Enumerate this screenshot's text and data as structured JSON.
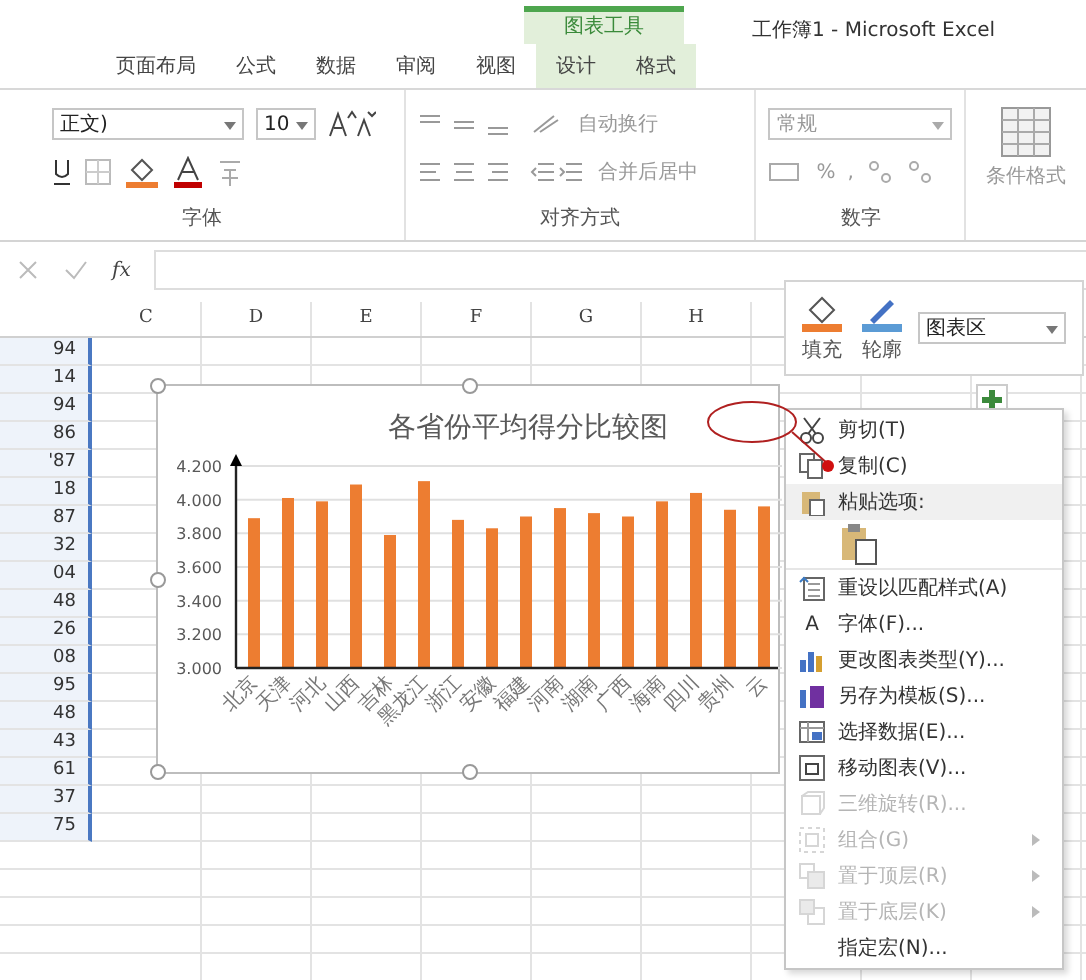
{
  "window": {
    "title": "工作簿1 - Microsoft Excel"
  },
  "ribbon": {
    "contextual_group": "图表工具",
    "tabs": [
      {
        "label": "页面布局",
        "contextual": false
      },
      {
        "label": "公式",
        "contextual": false
      },
      {
        "label": "数据",
        "contextual": false
      },
      {
        "label": "审阅",
        "contextual": false
      },
      {
        "label": "视图",
        "contextual": false
      },
      {
        "label": "设计",
        "contextual": true
      },
      {
        "label": "格式",
        "contextual": true
      }
    ],
    "font_group": {
      "font_name": "正文)",
      "font_size": "10",
      "label": "字体"
    },
    "alignment_group": {
      "wrap_text": "自动换行",
      "merge_center": "合并后居中",
      "label": "对齐方式"
    },
    "number_group": {
      "format": "常规",
      "percent": "%",
      "comma": ",",
      "label": "数字"
    },
    "styles_group": {
      "conditional_format": "条件格式"
    }
  },
  "formula_bar": {
    "fx": "fx"
  },
  "sheet": {
    "columns": [
      "C",
      "D",
      "E",
      "F",
      "G",
      "H"
    ],
    "cells": [
      "94",
      "14",
      "94",
      "86",
      "'87",
      "18",
      "87",
      "32",
      "04",
      "48",
      "26",
      "08",
      "95",
      "48",
      "43",
      "61",
      "37",
      "75"
    ]
  },
  "chart": {
    "chart_data": {
      "type": "bar",
      "title": "各省份平均得分比较图",
      "grid": true,
      "categories": [
        "北京",
        "天津",
        "河北",
        "山西",
        "吉林",
        "黑龙江",
        "浙江",
        "安徽",
        "福建",
        "河南",
        "湖南",
        "广西",
        "海南",
        "四川",
        "贵州",
        "云"
      ],
      "series": [
        {
          "color": "#ed7d31",
          "values": [
            3.89,
            4.01,
            3.99,
            4.09,
            3.79,
            4.11,
            3.88,
            3.83,
            3.9,
            3.95,
            3.92,
            3.9,
            3.99,
            4.04,
            3.94,
            3.96
          ]
        }
      ],
      "ylim": [
        3.0,
        4.2
      ],
      "yticks": [
        {
          "value": 3.0,
          "label": "3.000"
        },
        {
          "value": 3.2,
          "label": "3.200"
        },
        {
          "value": 3.4,
          "label": "3.400"
        },
        {
          "value": 3.6,
          "label": "3.600"
        },
        {
          "value": 3.8,
          "label": "3.800"
        },
        {
          "value": 4.0,
          "label": "4.000"
        },
        {
          "value": 4.2,
          "label": "4.200"
        }
      ]
    }
  },
  "mini_toolbar": {
    "fill": "填充",
    "outline": "轮廓",
    "element": "图表区"
  },
  "context_menu": [
    {
      "kind": "item",
      "label": "剪切(T)",
      "disabled": false,
      "submenu": false
    },
    {
      "kind": "item",
      "label": "复制(C)",
      "disabled": false,
      "submenu": false
    },
    {
      "kind": "header",
      "label": "粘贴选项:"
    },
    {
      "kind": "paste"
    },
    {
      "kind": "item",
      "label": "重设以匹配样式(A)",
      "disabled": false,
      "submenu": false
    },
    {
      "kind": "item",
      "glyph": "A",
      "label": "字体(F)...",
      "disabled": false,
      "submenu": false
    },
    {
      "kind": "item",
      "label": "更改图表类型(Y)...",
      "disabled": false,
      "submenu": false
    },
    {
      "kind": "item",
      "label": "另存为模板(S)...",
      "disabled": false,
      "submenu": false
    },
    {
      "kind": "item",
      "label": "选择数据(E)...",
      "disabled": false,
      "submenu": false
    },
    {
      "kind": "item",
      "label": "移动图表(V)...",
      "disabled": false,
      "submenu": false
    },
    {
      "kind": "item",
      "label": "三维旋转(R)...",
      "disabled": true,
      "submenu": false
    },
    {
      "kind": "item",
      "label": "组合(G)",
      "disabled": true,
      "submenu": true
    },
    {
      "kind": "item",
      "label": "置于顶层(R)",
      "disabled": true,
      "submenu": true
    },
    {
      "kind": "item",
      "label": "置于底层(K)",
      "disabled": true,
      "submenu": true
    },
    {
      "kind": "item",
      "label": "指定宏(N)...",
      "disabled": false,
      "submenu": false
    }
  ]
}
